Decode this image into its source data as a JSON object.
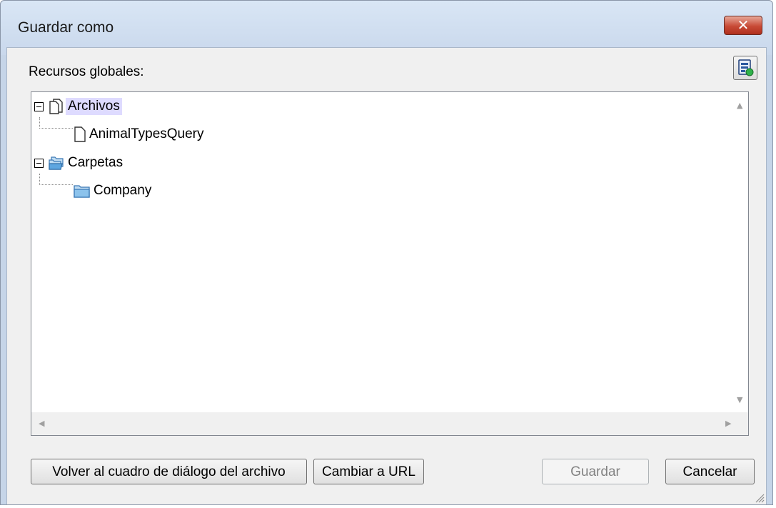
{
  "window": {
    "title": "Guardar como",
    "close_glyph": "✕"
  },
  "dialog": {
    "label": "Recursos globales:",
    "toolbar_icon": "global-resources-config-icon"
  },
  "tree": {
    "nodes": [
      {
        "label": "Archivos",
        "icon": "files-icon",
        "selected": true,
        "expanded": true
      },
      {
        "label": "AnimalTypesQuery",
        "icon": "file-icon"
      },
      {
        "label": "Carpetas",
        "icon": "folders-icon",
        "expanded": true
      },
      {
        "label": "Company",
        "icon": "folder-icon"
      }
    ]
  },
  "buttons": {
    "back": "Volver al cuadro de diálogo del archivo",
    "url": "Cambiar a URL",
    "save": "Guardar",
    "cancel": "Cancelar"
  },
  "colors": {
    "selection": "#dedbff",
    "close": "#c84a36",
    "folder": "#5ea6e0"
  }
}
